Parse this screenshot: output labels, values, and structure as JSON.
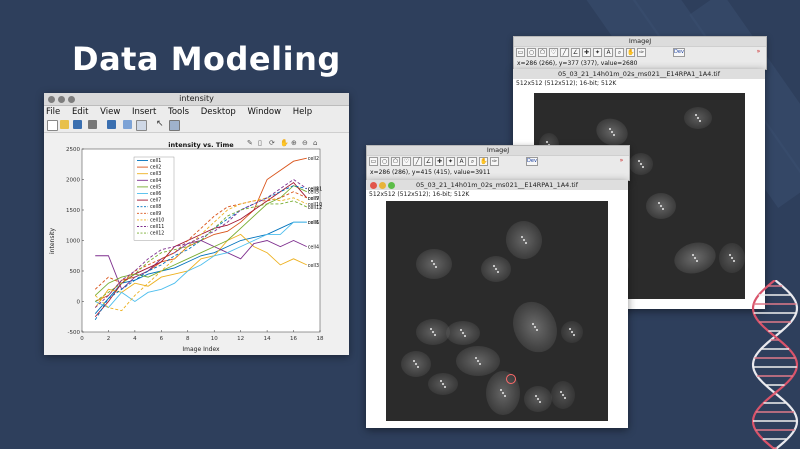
{
  "slide": {
    "title": "Data Modeling"
  },
  "matlab": {
    "window_title": "intensity",
    "menus": [
      "File",
      "Edit",
      "View",
      "Insert",
      "Tools",
      "Desktop",
      "Window",
      "Help"
    ]
  },
  "chart_data": {
    "type": "line",
    "title": "intensity vs. Time",
    "xlabel": "Image Index",
    "ylabel": "intensity",
    "xlim": [
      0,
      18
    ],
    "ylim": [
      -500,
      2500
    ],
    "xticks": [
      0,
      2,
      4,
      6,
      8,
      10,
      12,
      14,
      16,
      18
    ],
    "yticks": [
      -500,
      0,
      500,
      1000,
      1500,
      2000,
      2500
    ],
    "legend_position": "top-left",
    "grid": false,
    "x": [
      1,
      2,
      3,
      4,
      5,
      6,
      7,
      8,
      9,
      10,
      11,
      12,
      13,
      14,
      15,
      16,
      17
    ],
    "series": [
      {
        "name": "cell1",
        "color": "#0072bd",
        "dash": false,
        "values": [
          -200,
          50,
          300,
          350,
          450,
          500,
          550,
          650,
          750,
          800,
          900,
          1000,
          1050,
          1100,
          1200,
          1300,
          1300
        ]
      },
      {
        "name": "cell2",
        "color": "#d95319",
        "dash": false,
        "values": [
          0,
          100,
          350,
          400,
          500,
          650,
          700,
          900,
          1000,
          1100,
          1150,
          1300,
          1500,
          2000,
          2150,
          2300,
          2350
        ]
      },
      {
        "name": "cell3",
        "color": "#edb120",
        "dash": false,
        "values": [
          -100,
          200,
          150,
          300,
          250,
          400,
          450,
          500,
          700,
          750,
          1000,
          1100,
          900,
          800,
          600,
          700,
          600
        ]
      },
      {
        "name": "cell4",
        "color": "#7e2f8e",
        "dash": false,
        "values": [
          750,
          750,
          200,
          400,
          500,
          700,
          800,
          950,
          1000,
          900,
          800,
          700,
          950,
          1000,
          900,
          1000,
          900
        ]
      },
      {
        "name": "cell5",
        "color": "#77ac30",
        "dash": false,
        "values": [
          100,
          300,
          400,
          450,
          400,
          500,
          600,
          700,
          800,
          900,
          1000,
          1200,
          1400,
          1600,
          1700,
          1900,
          1800
        ]
      },
      {
        "name": "cell6",
        "color": "#4dbeee",
        "dash": false,
        "values": [
          0,
          -100,
          150,
          0,
          150,
          200,
          300,
          500,
          600,
          750,
          800,
          900,
          1000,
          1100,
          1100,
          1300,
          1300
        ]
      },
      {
        "name": "cell7",
        "color": "#a2142f",
        "dash": false,
        "values": [
          -250,
          0,
          300,
          450,
          550,
          650,
          900,
          1000,
          1100,
          1200,
          1250,
          1350,
          1500,
          1650,
          1800,
          1950,
          1700
        ]
      },
      {
        "name": "cell8",
        "color": "#0072bd",
        "dash": true,
        "values": [
          -300,
          50,
          200,
          350,
          500,
          600,
          750,
          850,
          1000,
          1200,
          1350,
          1500,
          1600,
          1700,
          1800,
          1900,
          1850
        ]
      },
      {
        "name": "cell9",
        "color": "#d95319",
        "dash": true,
        "values": [
          200,
          400,
          300,
          500,
          600,
          700,
          800,
          1000,
          1200,
          1400,
          1550,
          1600,
          1650,
          1650,
          1700,
          1800,
          1700
        ]
      },
      {
        "name": "cell10",
        "color": "#edb120",
        "dash": true,
        "values": [
          100,
          -100,
          -150,
          100,
          300,
          500,
          700,
          900,
          1100,
          1300,
          1500,
          1600,
          1650,
          1700,
          1650,
          1700,
          1600
        ]
      },
      {
        "name": "cell11",
        "color": "#7e2f8e",
        "dash": true,
        "values": [
          -100,
          100,
          350,
          500,
          700,
          850,
          900,
          950,
          1050,
          1150,
          1300,
          1500,
          1600,
          1700,
          1850,
          2000,
          1850
        ]
      },
      {
        "name": "cell12",
        "color": "#77ac30",
        "dash": true,
        "values": [
          0,
          150,
          300,
          450,
          650,
          800,
          850,
          900,
          1000,
          1200,
          1400,
          1500,
          1550,
          1600,
          1600,
          1650,
          1550
        ]
      }
    ]
  },
  "imagej_back": {
    "title": "ImageJ",
    "status": "x=286 (266), y=377 (377), value=2680",
    "image_title": "05_03_21_14h01m_02s_ms021__E14RPA1_1A4.tif",
    "image_info": "512x512   (512x512); 16-bit; 512K"
  },
  "imagej_front": {
    "title": "ImageJ",
    "status": "x=286 (286), y=415 (415), value=3911",
    "image_title": "05_03_21_14h01m_02s_ms021__E14RPA1_1A4.tif",
    "image_info": "512x512   (512x512); 16-bit; 512K"
  },
  "icons": [
    "rectangle-tool-icon",
    "oval-tool-icon",
    "polygon-tool-icon",
    "freehand-tool-icon",
    "line-tool-icon",
    "angle-tool-icon",
    "point-tool-icon",
    "wand-tool-icon",
    "text-tool-icon",
    "magnifier-tool-icon",
    "hand-tool-icon",
    "dropper-tool-icon",
    "more-tools-icon"
  ]
}
